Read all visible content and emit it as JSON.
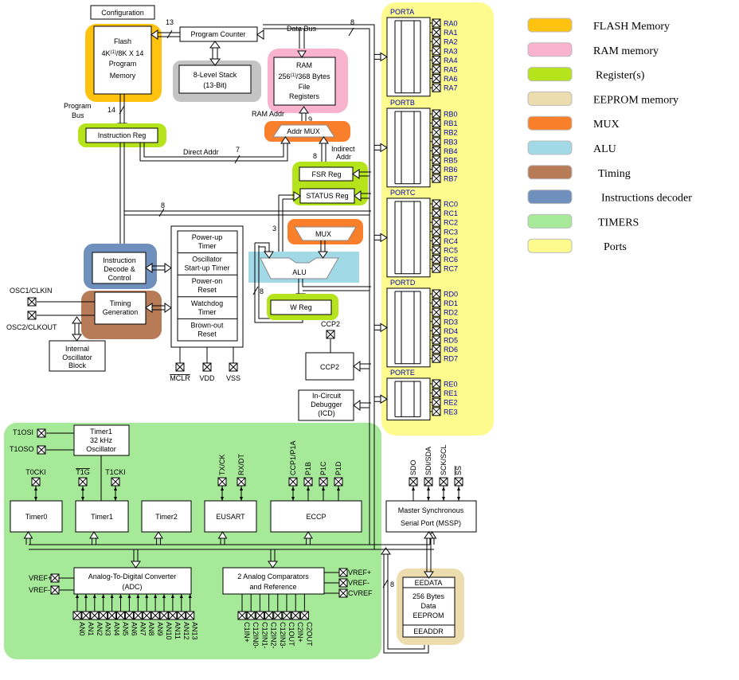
{
  "colors": {
    "flash": "#ffc20e",
    "ram": "#f9b3cc",
    "register": "#b5e31c",
    "eeprom": "#ecdcae",
    "mux": "#fa7f2a",
    "alu": "#a2d9e7",
    "timing": "#b77b57",
    "decoder": "#6f8fbd",
    "timers": "#a6e999",
    "ports": "#fdfb8e",
    "stack": "#c4c4c4"
  },
  "core": {
    "configuration": "Configuration",
    "flash": [
      "Flash",
      "4K",
      "(1)",
      "/8K X 14",
      "Program",
      "Memory"
    ],
    "program_counter": "Program Counter",
    "stack": [
      "8-Level Stack",
      "(13-Bit)"
    ],
    "ram": [
      "RAM",
      "256",
      "(1)",
      "/368 Bytes",
      "File",
      "Registers"
    ],
    "data_bus": "Data Bus",
    "program_bus": [
      "Program",
      "Bus"
    ],
    "instruction_reg": "Instruction Reg",
    "ram_addr": "RAM Addr",
    "addr_mux": "Addr MUX",
    "direct_addr": "Direct Addr",
    "indirect_addr": [
      "Indirect",
      "Addr"
    ],
    "fsr_reg": "FSR Reg",
    "status_reg": "STATUS Reg",
    "mux": "MUX",
    "alu": "ALU",
    "w_reg": "W Reg",
    "instruction_decode": [
      "Instruction",
      "Decode &",
      "Control"
    ],
    "timing": [
      "Timing",
      "Generation"
    ],
    "osc1": "OSC1/CLKIN",
    "osc2": "OSC2/CLKOUT",
    "internal_osc": [
      "Internal",
      "Oscillator",
      "Block"
    ],
    "reset_block": [
      [
        "Power-up",
        "Timer"
      ],
      [
        "Oscillator",
        "Start-up Timer"
      ],
      [
        "Power-on",
        "Reset"
      ],
      [
        "Watchdog",
        "Timer"
      ],
      [
        "Brown-out",
        "Reset"
      ]
    ],
    "supply_pins": [
      "MCLR",
      "VDD",
      "VSS"
    ],
    "ccp2_pin": "CCP2",
    "ccp2": "CCP2",
    "icd": [
      "In-Circuit",
      "Debugger",
      "(ICD)"
    ],
    "bus_widths": {
      "pc": "13",
      "data": "8",
      "prog": "14",
      "ramaddr": "9",
      "direct": "7",
      "indirect": "8",
      "alu_in": "8",
      "mux_in": "3",
      "w": "8",
      "eeprom": "8"
    }
  },
  "ports": [
    {
      "name": "PORTA",
      "pins": [
        "RA0",
        "RA1",
        "RA2",
        "RA3",
        "RA4",
        "RA5",
        "RA6",
        "RA7"
      ]
    },
    {
      "name": "PORTB",
      "pins": [
        "RB0",
        "RB1",
        "RB2",
        "RB3",
        "RB4",
        "RB5",
        "RB6",
        "RB7"
      ]
    },
    {
      "name": "PORTC",
      "pins": [
        "RC0",
        "RC1",
        "RC2",
        "RC3",
        "RC4",
        "RC5",
        "RC6",
        "RC7"
      ]
    },
    {
      "name": "PORTD",
      "pins": [
        "RD0",
        "RD1",
        "RD2",
        "RD3",
        "RD4",
        "RD5",
        "RD6",
        "RD7"
      ]
    },
    {
      "name": "PORTE",
      "pins": [
        "RE0",
        "RE1",
        "RE2",
        "RE3"
      ]
    }
  ],
  "peripherals": {
    "timer1_osc": [
      "Timer1",
      "32 kHz",
      "Oscillator"
    ],
    "t1osi": "T1OSI",
    "t1oso": "T1OSO",
    "timer_pins": [
      "T0CKI",
      "T1G",
      "T1CKI"
    ],
    "timer0": "Timer0",
    "timer1": "Timer1",
    "timer2": "Timer2",
    "eusart": "EUSART",
    "eusart_pins": [
      "TX/CK",
      "RX/DT"
    ],
    "eccp": "ECCP",
    "eccp_pins": [
      "CCP1/P1A",
      "P1B",
      "P1C",
      "P1D"
    ],
    "mssp": [
      "Master Synchronous",
      "Serial Port (MSSP)"
    ],
    "mssp_pins": [
      "SDO",
      "SDI/SDA",
      "SCK/SCL",
      "SS"
    ],
    "adc": [
      "Analog-To-Digital Converter",
      "(ADC)"
    ],
    "adc_vref": [
      "VREF+",
      "VREF-"
    ],
    "adc_pins": [
      "AN0",
      "AN1",
      "AN2",
      "AN3",
      "AN4",
      "AN5",
      "AN6",
      "AN7",
      "AN8",
      "AN9",
      "AN10",
      "AN11",
      "AN12",
      "AN13"
    ],
    "comparators": [
      "2 Analog Comparators",
      "and Reference"
    ],
    "comp_vref": [
      "VREF+",
      "VREF-",
      "CVREF"
    ],
    "comp_pins": [
      "C1IN+",
      "C12IN0-",
      "C12IN1-",
      "C12IN2-",
      "C12IN3-",
      "C1OUT",
      "C2IN+",
      "C2OUT"
    ],
    "eeprom": [
      "EEDATA",
      "256 Bytes",
      "Data",
      "EEPROM",
      "EEADDR"
    ]
  },
  "legend": [
    {
      "label": "FLASH Memory",
      "color": "#ffc20e"
    },
    {
      "label": "RAM memory",
      "color": "#f9b3cc"
    },
    {
      "label": "Register(s)",
      "color": "#b5e31c"
    },
    {
      "label": "EEPROM memory",
      "color": "#ecdcae"
    },
    {
      "label": "MUX",
      "color": "#fa7f2a"
    },
    {
      "label": "ALU",
      "color": "#a2d9e7"
    },
    {
      "label": "Timing",
      "color": "#b77b57"
    },
    {
      "label": "Instructions decoder",
      "color": "#6f8fbd"
    },
    {
      "label": "TIMERS",
      "color": "#a6e999"
    },
    {
      "label": "Ports",
      "color": "#fdfb8e"
    }
  ]
}
